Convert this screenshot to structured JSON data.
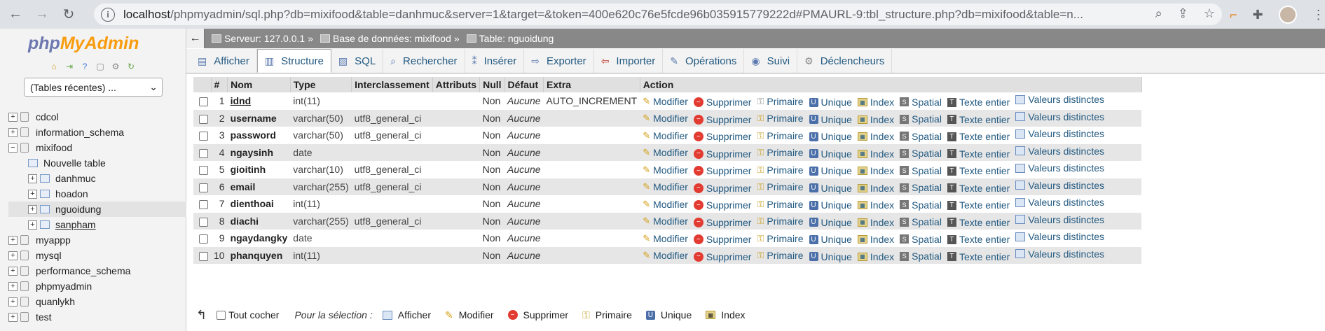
{
  "browser": {
    "url_host": "localhost",
    "url_path": "/phpmyadmin/sql.php?db=mixifood&table=danhmuc&server=1&target=&token=400e620c76e5fcde96b035915779222d#PMAURL-9:tbl_structure.php?db=mixifood&table=n..."
  },
  "sidebar": {
    "logo_php": "php",
    "logo_my": "My",
    "logo_admin": "Admin",
    "recent": "(Tables récentes) ...",
    "tree": [
      {
        "label": "cdcol"
      },
      {
        "label": "information_schema"
      },
      {
        "label": "mixifood"
      },
      {
        "label": "Nouvelle table"
      },
      {
        "label": "danhmuc"
      },
      {
        "label": "hoadon"
      },
      {
        "label": "nguoidung"
      },
      {
        "label": "sanpham"
      },
      {
        "label": "myappp"
      },
      {
        "label": "mysql"
      },
      {
        "label": "performance_schema"
      },
      {
        "label": "phpmyadmin"
      },
      {
        "label": "quanlykh"
      },
      {
        "label": "test"
      }
    ]
  },
  "breadcrumb": {
    "server": "Serveur: 127.0.0.1",
    "database": "Base de données: mixifood",
    "table": "Table: nguoidung"
  },
  "tabs": [
    "Afficher",
    "Structure",
    "SQL",
    "Rechercher",
    "Insérer",
    "Exporter",
    "Importer",
    "Opérations",
    "Suivi",
    "Déclencheurs"
  ],
  "table": {
    "headers": [
      "#",
      "Nom",
      "Type",
      "Interclassement",
      "Attributs",
      "Null",
      "Défaut",
      "Extra",
      "Action"
    ],
    "rows": [
      {
        "n": "1",
        "name": "idnd",
        "type": "int(11)",
        "coll": "",
        "attr": "",
        "null": "Non",
        "def": "Aucune",
        "extra": "AUTO_INCREMENT"
      },
      {
        "n": "2",
        "name": "username",
        "type": "varchar(50)",
        "coll": "utf8_general_ci",
        "attr": "",
        "null": "Non",
        "def": "Aucune",
        "extra": ""
      },
      {
        "n": "3",
        "name": "password",
        "type": "varchar(50)",
        "coll": "utf8_general_ci",
        "attr": "",
        "null": "Non",
        "def": "Aucune",
        "extra": ""
      },
      {
        "n": "4",
        "name": "ngaysinh",
        "type": "date",
        "coll": "",
        "attr": "",
        "null": "Non",
        "def": "Aucune",
        "extra": ""
      },
      {
        "n": "5",
        "name": "gioitinh",
        "type": "varchar(10)",
        "coll": "utf8_general_ci",
        "attr": "",
        "null": "Non",
        "def": "Aucune",
        "extra": ""
      },
      {
        "n": "6",
        "name": "email",
        "type": "varchar(255)",
        "coll": "utf8_general_ci",
        "attr": "",
        "null": "Non",
        "def": "Aucune",
        "extra": ""
      },
      {
        "n": "7",
        "name": "dienthoai",
        "type": "int(11)",
        "coll": "",
        "attr": "",
        "null": "Non",
        "def": "Aucune",
        "extra": ""
      },
      {
        "n": "8",
        "name": "diachi",
        "type": "varchar(255)",
        "coll": "utf8_general_ci",
        "attr": "",
        "null": "Non",
        "def": "Aucune",
        "extra": ""
      },
      {
        "n": "9",
        "name": "ngaydangky",
        "type": "date",
        "coll": "",
        "attr": "",
        "null": "Non",
        "def": "Aucune",
        "extra": ""
      },
      {
        "n": "10",
        "name": "phanquyen",
        "type": "int(11)",
        "coll": "",
        "attr": "",
        "null": "Non",
        "def": "Aucune",
        "extra": ""
      }
    ],
    "actions": [
      "Modifier",
      "Supprimer",
      "Primaire",
      "Unique",
      "Index",
      "Spatial",
      "Texte entier",
      "Valeurs distinctes"
    ]
  },
  "bulk": {
    "check_all": "Tout cocher",
    "for_selection": "Pour la sélection :",
    "actions": [
      "Afficher",
      "Modifier",
      "Supprimer",
      "Primaire",
      "Unique",
      "Index"
    ]
  }
}
